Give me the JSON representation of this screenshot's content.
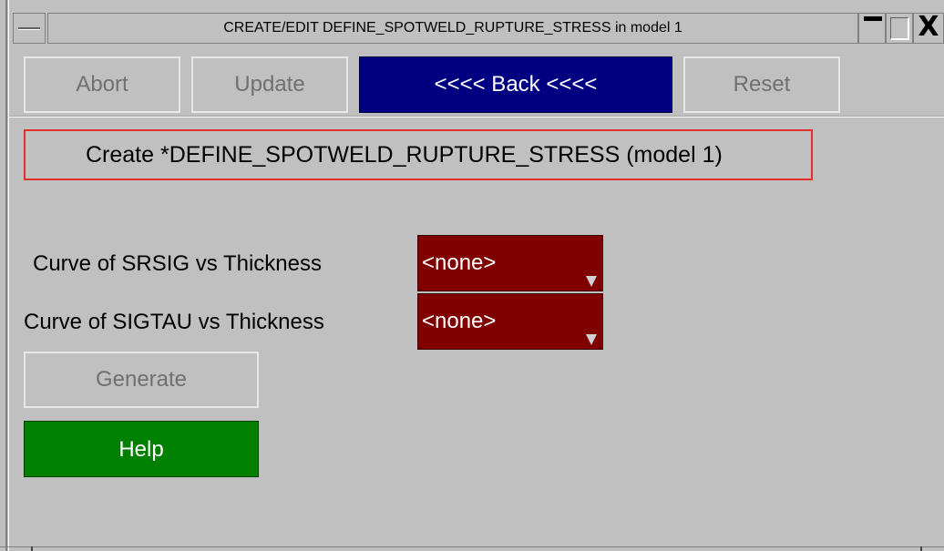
{
  "window": {
    "title": "CREATE/EDIT DEFINE_SPOTWELD_RUPTURE_STRESS in model 1",
    "close_glyph": "X",
    "icons": [
      "window-menu-icon",
      "minimize-icon",
      "maximize-icon",
      "close-icon"
    ]
  },
  "toolbar": {
    "abort_label": "Abort",
    "update_label": "Update",
    "back_label": "<<<< Back <<<<",
    "reset_label": "Reset"
  },
  "heading": {
    "text": "Create *DEFINE_SPOTWELD_RUPTURE_STRESS (model 1)"
  },
  "fields": {
    "srsig_label": "Curve of SRSIG vs Thickness",
    "srsig_value": "<none>",
    "sigtau_label": "Curve of SIGTAU vs Thickness",
    "sigtau_value": "<none>"
  },
  "actions": {
    "generate_label": "Generate",
    "help_label": "Help"
  },
  "colors": {
    "background": "#c0c0c0",
    "back_button": "#000080",
    "combo_background": "#800000",
    "help_button": "#008000",
    "heading_outline": "#e0302a",
    "disabled_text": "#707070"
  }
}
